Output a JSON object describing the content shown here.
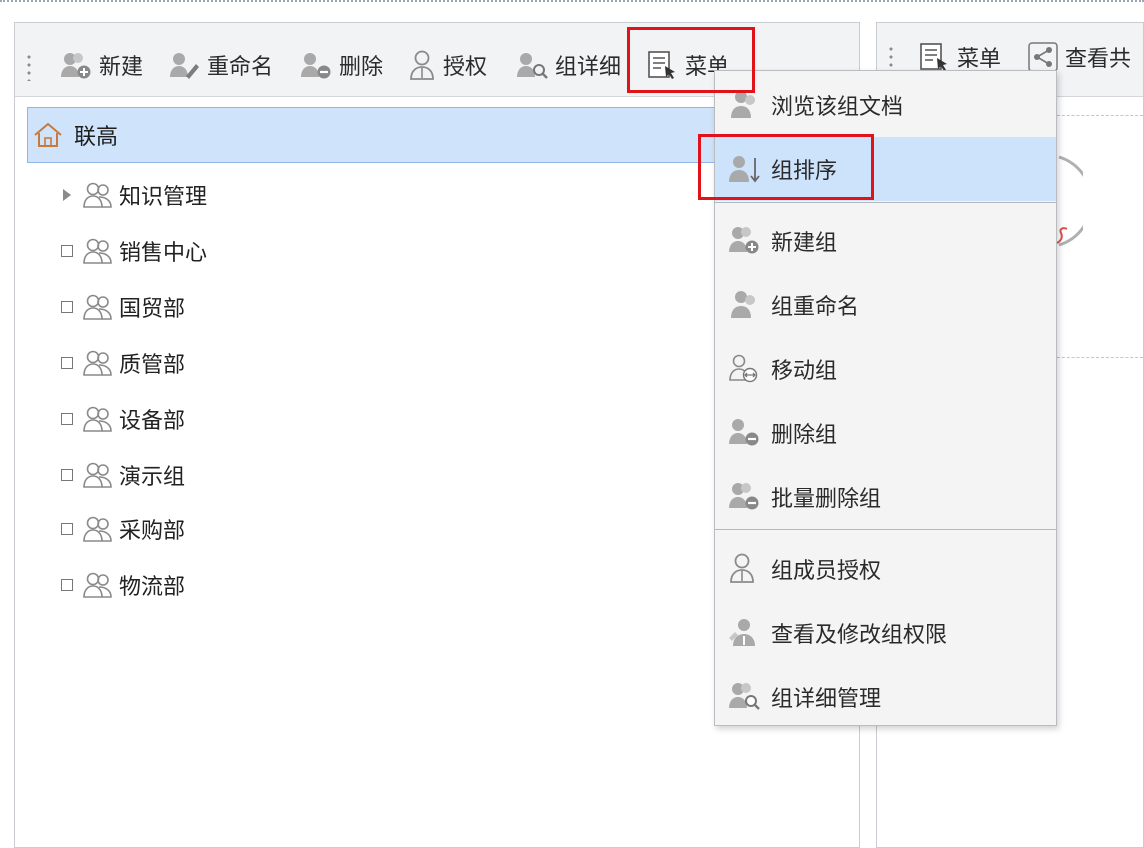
{
  "left_toolbar": {
    "buttons": [
      {
        "label": "新建",
        "icon": "add-group-icon"
      },
      {
        "label": "重命名",
        "icon": "rename-group-icon"
      },
      {
        "label": "删除",
        "icon": "delete-group-icon"
      },
      {
        "label": "授权",
        "icon": "authorize-user-icon"
      },
      {
        "label": "组详细",
        "icon": "group-detail-icon"
      },
      {
        "label": "菜单",
        "icon": "menu-doc-icon"
      }
    ]
  },
  "right_toolbar": {
    "buttons": [
      {
        "label": "菜单",
        "icon": "menu-doc-icon"
      },
      {
        "label": "查看共",
        "icon": "share-icon"
      }
    ]
  },
  "tree": {
    "root": {
      "label": "联高",
      "icon": "home-icon"
    },
    "items": [
      {
        "label": "知识管理",
        "expander": "triangle"
      },
      {
        "label": "销售中心",
        "expander": "checkbox"
      },
      {
        "label": "国贸部",
        "expander": "checkbox"
      },
      {
        "label": "质管部",
        "expander": "checkbox"
      },
      {
        "label": "设备部",
        "expander": "checkbox"
      },
      {
        "label": "演示组",
        "expander": "checkbox"
      },
      {
        "label": "采购部",
        "expander": "checkbox"
      },
      {
        "label": "物流部",
        "expander": "checkbox"
      }
    ]
  },
  "context_menu": {
    "items": [
      {
        "label": "浏览该组文档",
        "icon": "browse-group-docs-icon"
      },
      {
        "label": "组排序",
        "icon": "sort-group-icon",
        "selected": true
      },
      {
        "label": "新建组",
        "icon": "add-group-icon"
      },
      {
        "label": "组重命名",
        "icon": "rename-group-icon"
      },
      {
        "label": "移动组",
        "icon": "move-group-icon"
      },
      {
        "label": "删除组",
        "icon": "delete-group-icon"
      },
      {
        "label": "批量删除组",
        "icon": "batch-delete-group-icon"
      },
      {
        "label": "组成员授权",
        "icon": "member-authorize-icon"
      },
      {
        "label": "查看及修改组权限",
        "icon": "group-permission-icon"
      },
      {
        "label": "组详细管理",
        "icon": "group-detail-icon"
      }
    ]
  },
  "colors": {
    "highlight": "#cde2fb",
    "annotation_red": "#e0131b",
    "menu_bg": "#f4f4f5"
  }
}
